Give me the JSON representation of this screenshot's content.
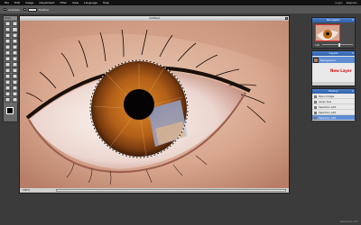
{
  "menubar": {
    "items": [
      "File",
      "Edit",
      "Image",
      "Adjustment",
      "Filter",
      "View",
      "Language",
      "Help"
    ],
    "right_links": [
      "Login",
      "Register"
    ]
  },
  "options": {
    "antialias_label": "Antialias",
    "feather_label": "Feather"
  },
  "tools": {
    "title": "Tools",
    "icons": [
      "crop-icon",
      "move-icon",
      "marquee-icon",
      "lasso-icon",
      "wand-icon",
      "pencil-icon",
      "brush-icon",
      "eraser-icon",
      "bucket-icon",
      "gradient-icon",
      "clone-icon",
      "color-replace-icon",
      "drawing-icon",
      "blur-icon",
      "sharpen-icon",
      "smudge-icon",
      "sponge-icon",
      "dodge-icon",
      "burn-icon",
      "redeye-icon",
      "spot-heal-icon",
      "bloat-icon",
      "pinch-icon",
      "text-icon",
      "hand-icon",
      "zoom-icon",
      "picker-icon",
      "fill-icon"
    ],
    "foreground_color": "#000000",
    "background_color": "#ffffff"
  },
  "image_window": {
    "title": "Untitled",
    "status": "100%"
  },
  "navigator": {
    "title": "Navigator",
    "zoom": "100"
  },
  "layers": {
    "title": "Layers",
    "layer_name": "Background",
    "note": "New Layer"
  },
  "history": {
    "title": "History",
    "entries": [
      "Open image",
      "Lasso tool",
      "Selection edit",
      "Selection edit",
      "Selection edit"
    ]
  },
  "credit": "www.pixlr.com"
}
